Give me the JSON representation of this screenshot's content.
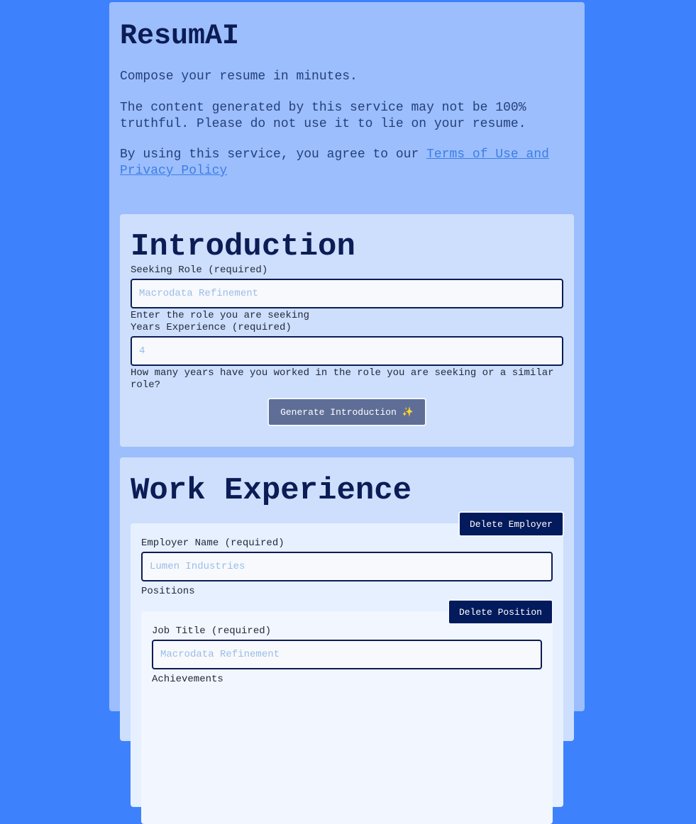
{
  "app": {
    "title": "ResumAI",
    "tagline": "Compose your resume in minutes.",
    "disclaimer": "The content generated by this service may not be 100% truthful. Please do not use it to lie on your resume.",
    "agreement_prefix": "By using this service, you agree to our ",
    "terms_link": "Terms of Use and Privacy Policy"
  },
  "introduction": {
    "title": "Introduction",
    "seeking_role_label": "Seeking Role (required)",
    "seeking_role_placeholder": "Macrodata Refinement",
    "seeking_role_help": "Enter the role you are seeking",
    "years_label": "Years Experience (required)",
    "years_placeholder": "4",
    "years_help": "How many years have you worked in the role you are seeking or a similar role?",
    "generate_label": "Generate Introduction ✨"
  },
  "work_experience": {
    "title": "Work Experience",
    "delete_employer_label": "Delete Employer",
    "employer_name_label": "Employer Name (required)",
    "employer_name_placeholder": "Lumen Industries",
    "positions_label": "Positions",
    "position": {
      "delete_position_label": "Delete Position",
      "job_title_label": "Job Title (required)",
      "job_title_placeholder": "Macrodata Refinement",
      "achievements_label": "Achievements"
    }
  },
  "colors": {
    "background": "#3d82fc",
    "page": "#9cbefd",
    "card": "#cddffd",
    "accent_dark": "#031a5c",
    "link": "#3d7ee4"
  }
}
